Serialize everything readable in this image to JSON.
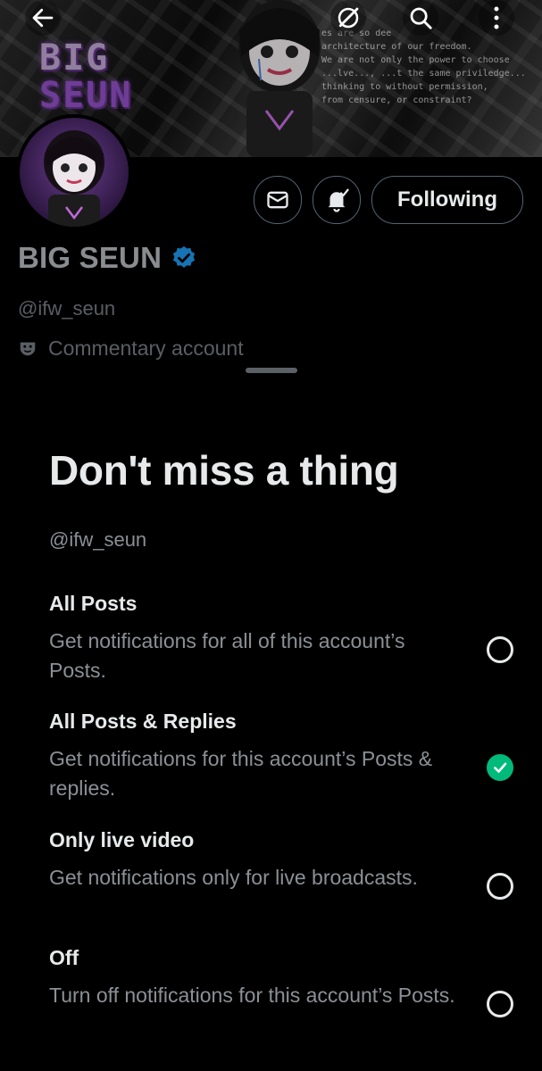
{
  "banner": {
    "title_line1": "BIG",
    "title_line2": "SEUN",
    "overlay_text": "es are so dee\narchitecture of our freedom.\nWe are not only the power to choose\n...lve..., ...t the same priviledge...\nthinking to without permission,\nfrom censure, or constraint?"
  },
  "top_bar": {
    "back_icon": "arrow-left-icon",
    "grok_icon": "slash-circle-icon",
    "search_icon": "search-icon",
    "more_icon": "more-vertical-icon"
  },
  "profile": {
    "display_name": "BIG SEUN",
    "verified_icon": "verified-badge-icon",
    "handle": "@ifw_seun",
    "category_icon": "theater-masks-icon",
    "category": "Commentary account",
    "message_icon": "envelope-icon",
    "notify_icon": "bell-check-icon",
    "follow_button": "Following"
  },
  "sheet": {
    "title": "Don't miss a thing",
    "handle": "@ifw_seun",
    "options": [
      {
        "title": "All Posts",
        "description": "Get notifications for all of this account’s Posts.",
        "selected": false
      },
      {
        "title": "All Posts & Replies",
        "description": "Get notifications for this account’s Posts & replies.",
        "selected": true
      },
      {
        "title": "Only live video",
        "description": "Get notifications only for live broadcasts.",
        "selected": false
      },
      {
        "title": "Off",
        "description": "Turn off notifications for this account’s Posts.",
        "selected": false
      }
    ]
  },
  "colors": {
    "background": "#000000",
    "text_primary": "#e7e9ea",
    "text_secondary": "#8b9095",
    "verified_blue": "#1d9bf0",
    "selected_green": "#00ba7c"
  }
}
